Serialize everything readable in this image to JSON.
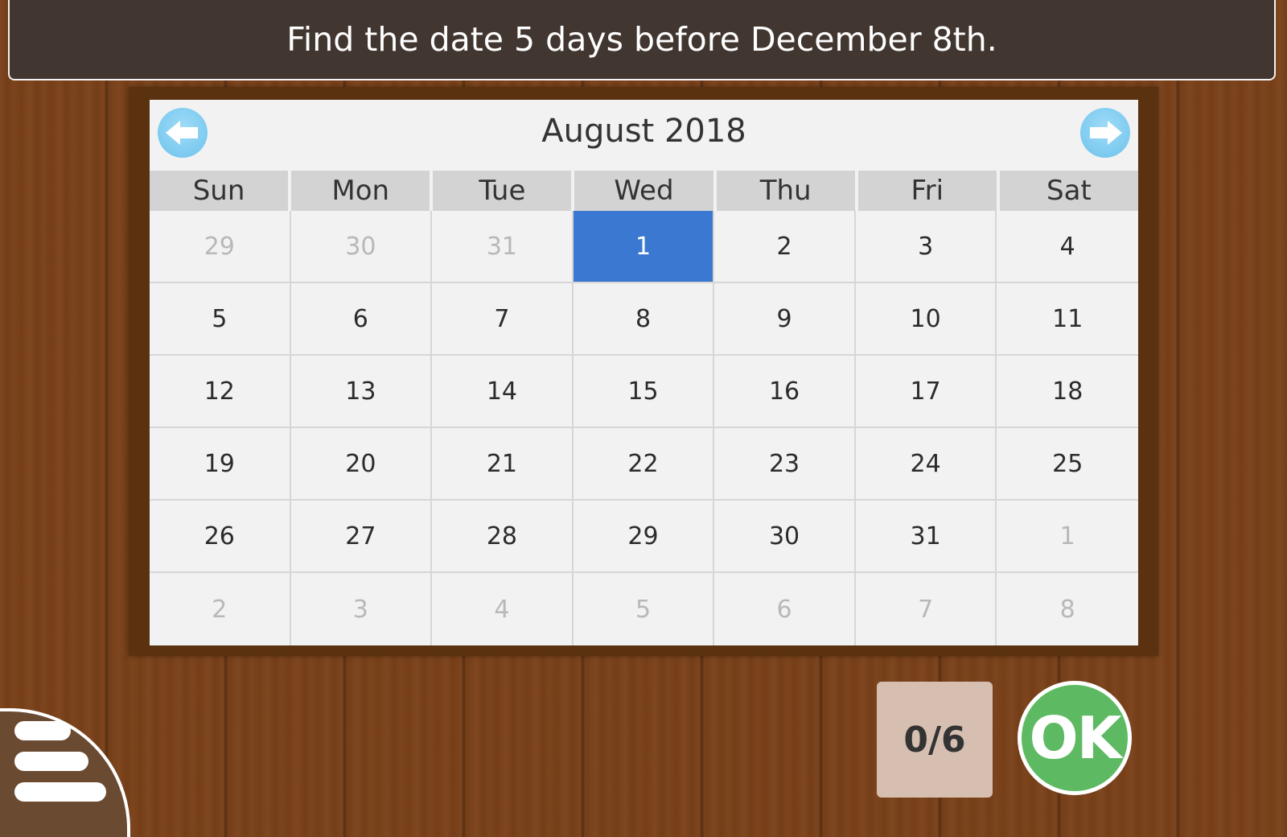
{
  "prompt": "Find the date 5 days before December 8th.",
  "calendar": {
    "month_label": "August 2018",
    "weekdays": [
      "Sun",
      "Mon",
      "Tue",
      "Wed",
      "Thu",
      "Fri",
      "Sat"
    ],
    "days": [
      {
        "label": "29",
        "current": false,
        "selected": false
      },
      {
        "label": "30",
        "current": false,
        "selected": false
      },
      {
        "label": "31",
        "current": false,
        "selected": false
      },
      {
        "label": "1",
        "current": true,
        "selected": true
      },
      {
        "label": "2",
        "current": true,
        "selected": false
      },
      {
        "label": "3",
        "current": true,
        "selected": false
      },
      {
        "label": "4",
        "current": true,
        "selected": false
      },
      {
        "label": "5",
        "current": true,
        "selected": false
      },
      {
        "label": "6",
        "current": true,
        "selected": false
      },
      {
        "label": "7",
        "current": true,
        "selected": false
      },
      {
        "label": "8",
        "current": true,
        "selected": false
      },
      {
        "label": "9",
        "current": true,
        "selected": false
      },
      {
        "label": "10",
        "current": true,
        "selected": false
      },
      {
        "label": "11",
        "current": true,
        "selected": false
      },
      {
        "label": "12",
        "current": true,
        "selected": false
      },
      {
        "label": "13",
        "current": true,
        "selected": false
      },
      {
        "label": "14",
        "current": true,
        "selected": false
      },
      {
        "label": "15",
        "current": true,
        "selected": false
      },
      {
        "label": "16",
        "current": true,
        "selected": false
      },
      {
        "label": "17",
        "current": true,
        "selected": false
      },
      {
        "label": "18",
        "current": true,
        "selected": false
      },
      {
        "label": "19",
        "current": true,
        "selected": false
      },
      {
        "label": "20",
        "current": true,
        "selected": false
      },
      {
        "label": "21",
        "current": true,
        "selected": false
      },
      {
        "label": "22",
        "current": true,
        "selected": false
      },
      {
        "label": "23",
        "current": true,
        "selected": false
      },
      {
        "label": "24",
        "current": true,
        "selected": false
      },
      {
        "label": "25",
        "current": true,
        "selected": false
      },
      {
        "label": "26",
        "current": true,
        "selected": false
      },
      {
        "label": "27",
        "current": true,
        "selected": false
      },
      {
        "label": "28",
        "current": true,
        "selected": false
      },
      {
        "label": "29",
        "current": true,
        "selected": false
      },
      {
        "label": "30",
        "current": true,
        "selected": false
      },
      {
        "label": "31",
        "current": true,
        "selected": false
      },
      {
        "label": "1",
        "current": false,
        "selected": false
      },
      {
        "label": "2",
        "current": false,
        "selected": false
      },
      {
        "label": "3",
        "current": false,
        "selected": false
      },
      {
        "label": "4",
        "current": false,
        "selected": false
      },
      {
        "label": "5",
        "current": false,
        "selected": false
      },
      {
        "label": "6",
        "current": false,
        "selected": false
      },
      {
        "label": "7",
        "current": false,
        "selected": false
      },
      {
        "label": "8",
        "current": false,
        "selected": false
      }
    ],
    "prev_icon": "arrow-left-icon",
    "next_icon": "arrow-right-icon"
  },
  "score": {
    "label": "0/6"
  },
  "ok_button": {
    "label": "OK"
  },
  "menu": {
    "icon": "hamburger-menu-icon"
  },
  "colors": {
    "background_wood": "#7a4119",
    "header_bg": "#423631",
    "selected_day": "#3a78d1",
    "ok_green": "#5dba62",
    "nav_arrow_blue": "#7ccaf0",
    "score_bg": "#d6bfb1"
  }
}
